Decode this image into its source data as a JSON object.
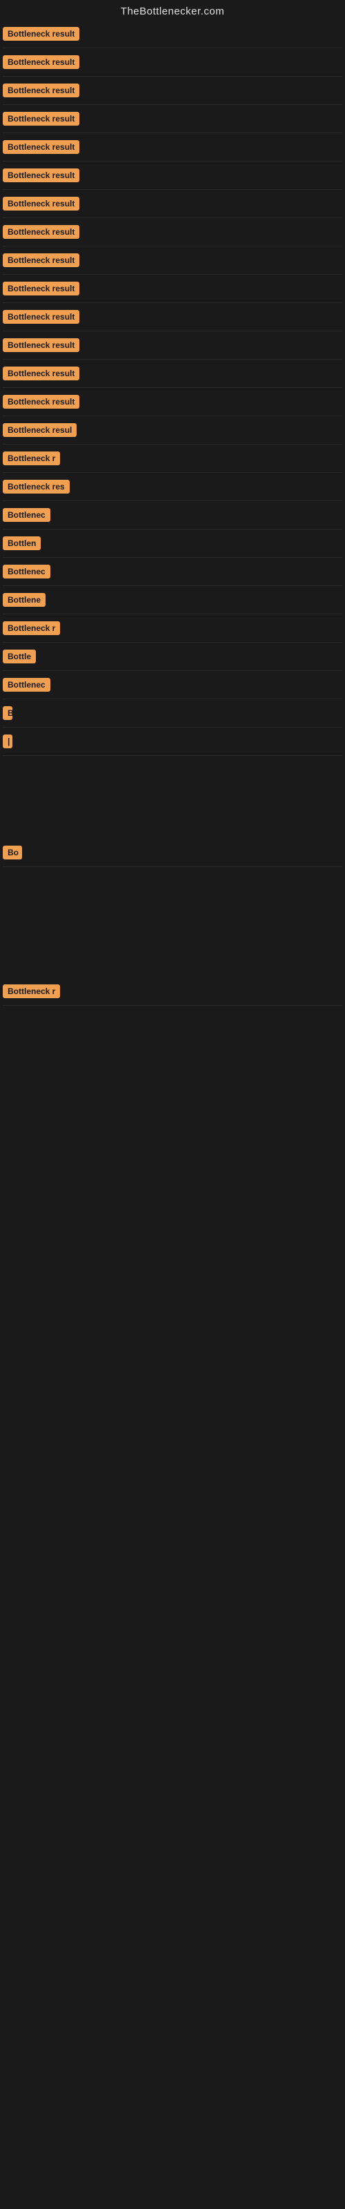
{
  "site": {
    "title": "TheBottlenecker.com"
  },
  "items": [
    {
      "id": 1,
      "label": "Bottleneck result"
    },
    {
      "id": 2,
      "label": "Bottleneck result"
    },
    {
      "id": 3,
      "label": "Bottleneck result"
    },
    {
      "id": 4,
      "label": "Bottleneck result"
    },
    {
      "id": 5,
      "label": "Bottleneck result"
    },
    {
      "id": 6,
      "label": "Bottleneck result"
    },
    {
      "id": 7,
      "label": "Bottleneck result"
    },
    {
      "id": 8,
      "label": "Bottleneck result"
    },
    {
      "id": 9,
      "label": "Bottleneck result"
    },
    {
      "id": 10,
      "label": "Bottleneck result"
    },
    {
      "id": 11,
      "label": "Bottleneck result"
    },
    {
      "id": 12,
      "label": "Bottleneck result"
    },
    {
      "id": 13,
      "label": "Bottleneck result"
    },
    {
      "id": 14,
      "label": "Bottleneck result"
    },
    {
      "id": 15,
      "label": "Bottleneck resul"
    },
    {
      "id": 16,
      "label": "Bottleneck r"
    },
    {
      "id": 17,
      "label": "Bottleneck res"
    },
    {
      "id": 18,
      "label": "Bottlenec"
    },
    {
      "id": 19,
      "label": "Bottlen"
    },
    {
      "id": 20,
      "label": "Bottlenec"
    },
    {
      "id": 21,
      "label": "Bottlene"
    },
    {
      "id": 22,
      "label": "Bottleneck r"
    },
    {
      "id": 23,
      "label": "Bottle"
    },
    {
      "id": 24,
      "label": "Bottlenec"
    },
    {
      "id": 25,
      "label": "B"
    },
    {
      "id": 26,
      "label": "|"
    }
  ],
  "gap_items": [
    {
      "id": 27,
      "label": "Bo"
    },
    {
      "id": 28,
      "label": "Bottleneck r"
    }
  ]
}
